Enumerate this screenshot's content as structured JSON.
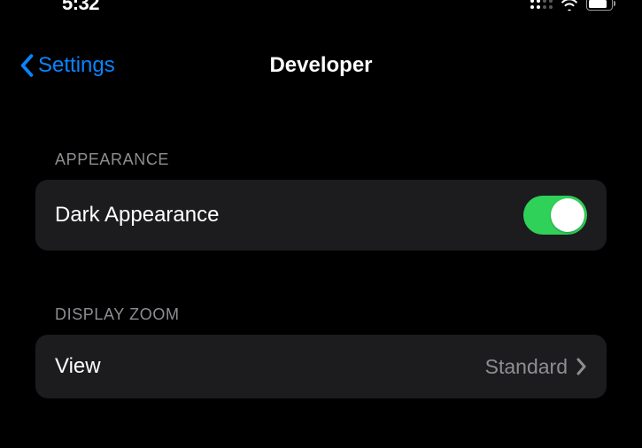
{
  "status": {
    "time": "5:32"
  },
  "nav": {
    "back_label": "Settings",
    "title": "Developer"
  },
  "sections": {
    "appearance": {
      "header": "Appearance",
      "dark_appearance_label": "Dark Appearance",
      "dark_appearance_on": true
    },
    "display_zoom": {
      "header": "Display Zoom",
      "view_label": "View",
      "view_value": "Standard"
    }
  },
  "colors": {
    "tint": "#0a84ff",
    "toggle_on": "#30d158",
    "row_bg": "#1c1c1e",
    "secondary_text": "#8e8e93"
  }
}
